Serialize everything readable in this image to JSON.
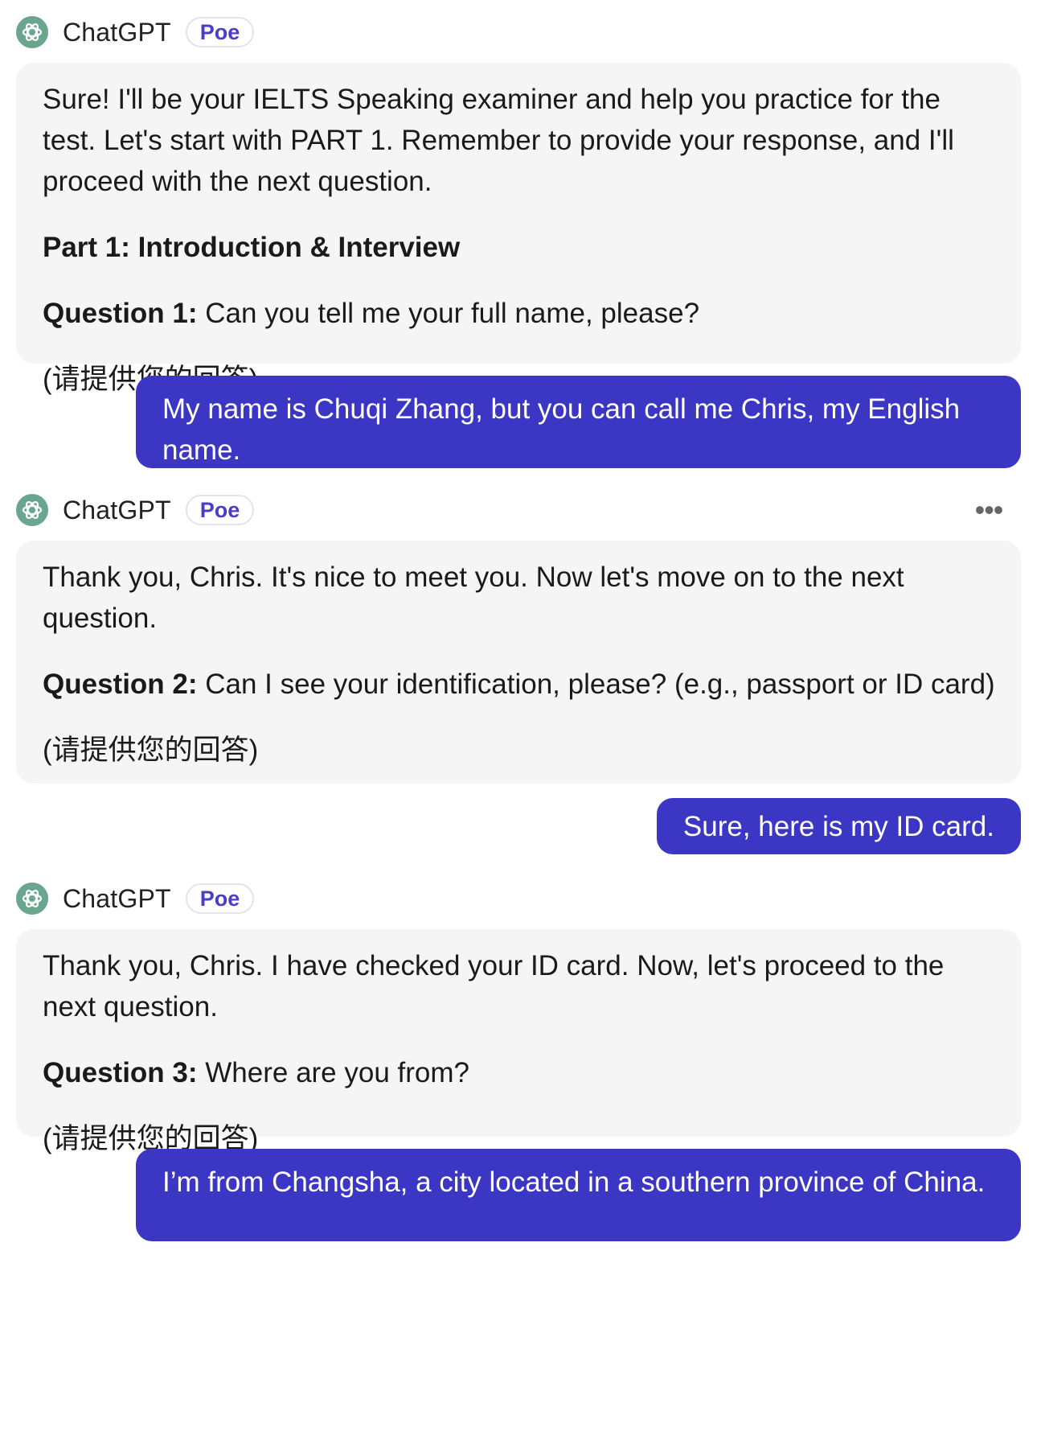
{
  "messages": [
    {
      "role": "bot",
      "sender": "ChatGPT",
      "badge": "Poe",
      "intro": "Sure! I'll be your IELTS Speaking examiner and help you practice for the test. Let's start with PART 1. Remember to provide your response, and I'll proceed with the next question.",
      "section_heading": "Part 1: Introduction & Interview",
      "question_label": "Question 1:",
      "question_text": " Can you tell me your full name, please?",
      "response_prompt": "(请提供您的回答)"
    },
    {
      "role": "user",
      "text": "My name is Chuqi Zhang, but you can call me Chris, my English name."
    },
    {
      "role": "bot",
      "sender": "ChatGPT",
      "badge": "Poe",
      "more_icon": "more-horizontal-icon",
      "more_label": "•••",
      "intro": "Thank you, Chris. It's nice to meet you. Now let's move on to the next question.",
      "question_label": "Question 2:",
      "question_text": " Can I see your identification, please? (e.g., passport or ID card)",
      "response_prompt": "(请提供您的回答)"
    },
    {
      "role": "user",
      "text": "Sure, here is my ID card."
    },
    {
      "role": "bot",
      "sender": "ChatGPT",
      "badge": "Poe",
      "intro": "Thank you, Chris. I have checked your ID card. Now, let's proceed to the next question.",
      "question_label": "Question 3:",
      "question_text": " Where are you from?",
      "response_prompt": "(请提供您的回答)"
    },
    {
      "role": "user",
      "text": "I’m from Changsha, a city located in a southern province of China."
    }
  ],
  "colors": {
    "bot_bubble_bg": "#f5f5f5",
    "user_bubble_bg": "#3b37c4",
    "badge_text": "#4a3ec8",
    "avatar_bg": "#6aa58e"
  }
}
